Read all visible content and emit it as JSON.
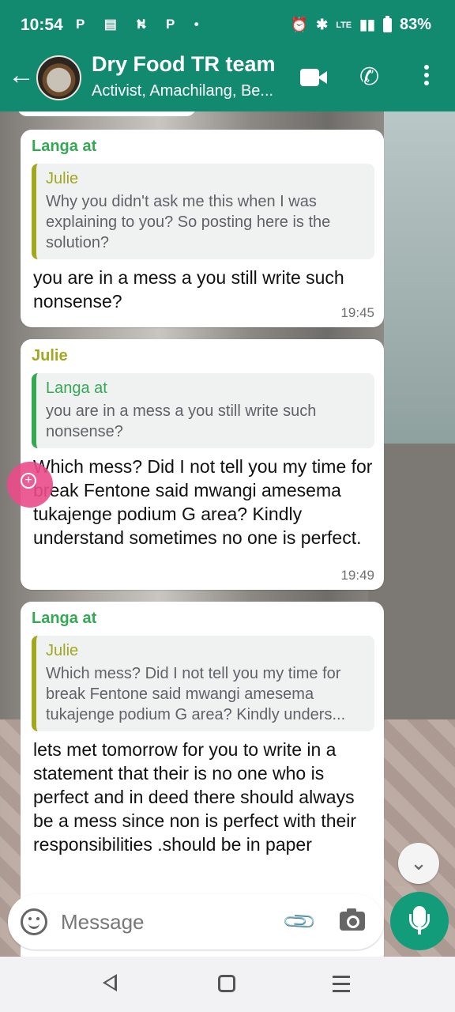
{
  "status_bar": {
    "time": "10:54",
    "notifications": "P ▤ ⛕ P •",
    "network": "LTE",
    "battery": "83%"
  },
  "header": {
    "title": "Dry Food TR team",
    "subtitle": "Activist, Amachilang, Be...",
    "back_icon": "arrow-left-icon",
    "video_icon": "video-call-icon",
    "call_icon": "phone-icon",
    "menu_icon": "more-vert-icon"
  },
  "messages": [
    {
      "sender": "Langa at",
      "quote_name": "Julie",
      "quote_text": "Why you didn't ask me this when I was explaining to you? So posting here is the solution?",
      "text": "you are in a mess a you still write such nonsense?",
      "time": "19:45"
    },
    {
      "sender": "Julie",
      "quote_name": "Langa at",
      "quote_text": "you are in a mess a you still write such nonsense?",
      "text": "Which mess? Did I not tell you my time for break Fentone said mwangi amesema tukajenge podium G area? Kindly understand sometimes no one is perfect.",
      "time": "19:49"
    },
    {
      "sender": "Langa at",
      "quote_name": "Julie",
      "quote_text": "Which mess? Did I not tell you my time for break Fentone said mwangi amesema tukajenge podium G area? Kindly unders...",
      "text": "lets met tomorrow for you to write in a statement that their is no one who is perfect  and in deed there should always be a mess since non is perfect with their responsibilities .should be in paper",
      "time": ""
    }
  ],
  "composer": {
    "placeholder": "Message",
    "emoji_icon": "emoji-icon",
    "attach_icon": "paperclip-icon",
    "camera_icon": "camera-icon",
    "mic_icon": "mic-icon"
  },
  "colors": {
    "header": "#128a6f",
    "sender_green": "#34a853",
    "sender_olive": "#a3a61f",
    "mic_button": "#129c7a"
  }
}
